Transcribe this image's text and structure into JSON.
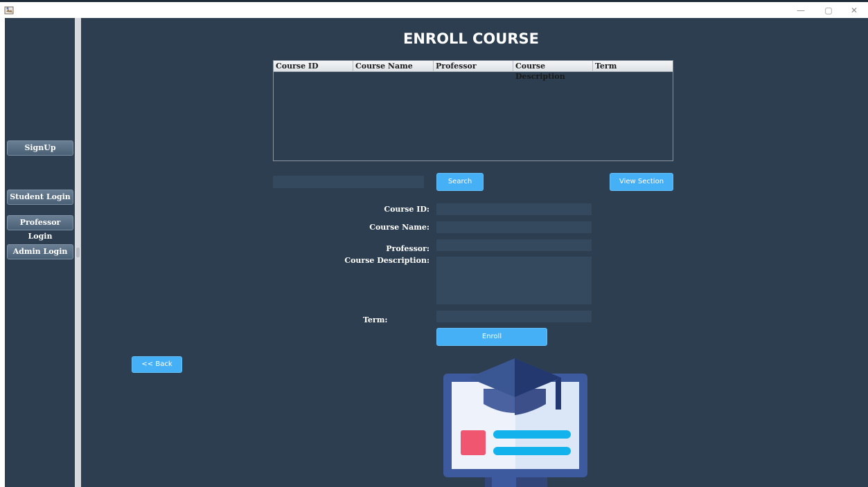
{
  "window": {
    "minimize_glyph": "—",
    "restore_glyph": "▢",
    "close_glyph": "✕",
    "icon": "java-app-icon"
  },
  "sidebar": {
    "signup_label": "SignUp",
    "student_login_label": "Student Login",
    "professor_login_label": "Professor Login",
    "admin_login_label": "Admin Login"
  },
  "page": {
    "title": "ENROLL COURSE"
  },
  "table": {
    "columns": [
      "Course ID",
      "Course Name",
      "Professor",
      "Course Description",
      "Term"
    ],
    "rows": []
  },
  "search": {
    "value": "",
    "button_label": "Search"
  },
  "view_section_label": "View Section",
  "form": {
    "course_id_label": "Course ID:",
    "course_name_label": "Course Name:",
    "professor_label": "Professor:",
    "course_description_label": "Course Description:",
    "term_label": "Term:",
    "course_id_value": "",
    "course_name_value": "",
    "professor_value": "",
    "course_description_value": "",
    "term_value": ""
  },
  "enroll_label": "Enroll",
  "back_label": "<< Back",
  "illustration": "graduation-monitor-illustration",
  "colors": {
    "background": "#2c3e50",
    "field": "#34495e",
    "accent_button": "#45b0f5",
    "sidebar_button": "#526a80"
  }
}
